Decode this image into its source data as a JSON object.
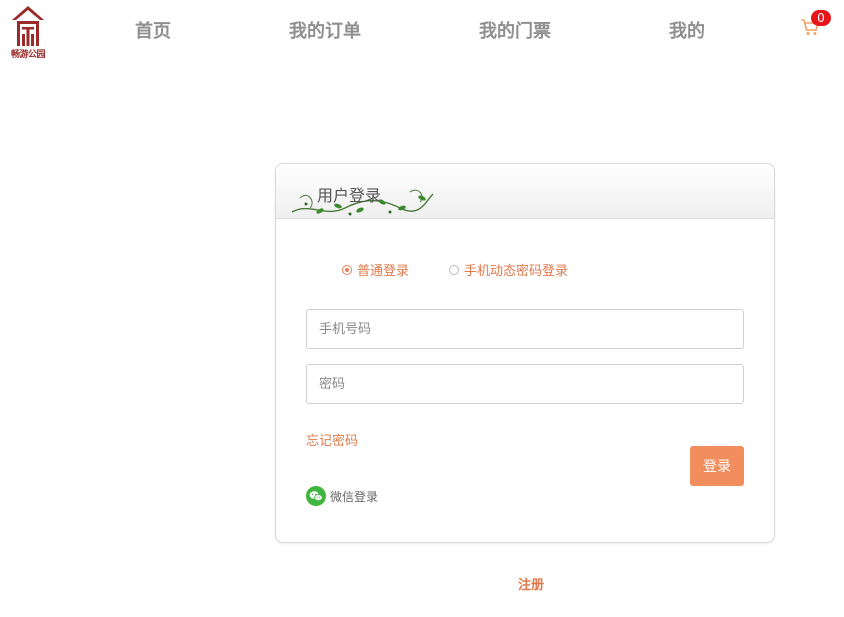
{
  "header": {
    "logo_text": "畅游公园",
    "nav": [
      "首页",
      "我的订单",
      "我的门票",
      "我的"
    ],
    "cart_count": "0"
  },
  "login": {
    "title": "用户登录",
    "modes": [
      {
        "label": "普通登录",
        "selected": true
      },
      {
        "label": "手机动态密码登录",
        "selected": false
      }
    ],
    "phone_placeholder": "手机号码",
    "password_placeholder": "密码",
    "forgot_label": "忘记密码",
    "login_label": "登录",
    "wechat_label": "微信登录"
  },
  "register_label": "注册",
  "colors": {
    "accent": "#e07a4c",
    "button": "#f28d5d",
    "badge": "#e8141b",
    "logo": "#9b2a2a",
    "wechat": "#3fb53f"
  }
}
